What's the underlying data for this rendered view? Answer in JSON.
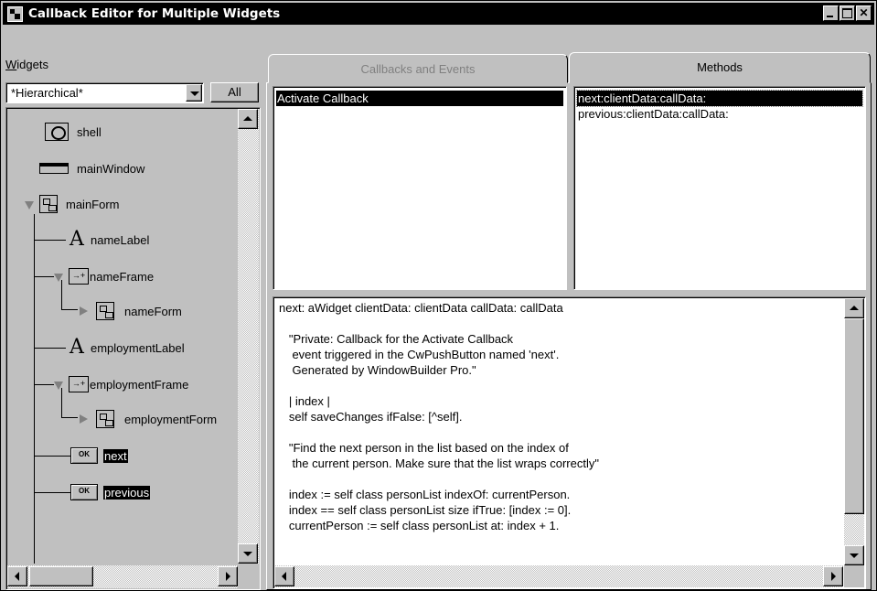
{
  "window": {
    "title": "Callback Editor for Multiple Widgets",
    "controls": [
      "minimize-icon",
      "maximize-icon",
      "close-icon"
    ]
  },
  "widgets_panel": {
    "label_underlined": "W",
    "label_rest": "idgets",
    "filter_value": "*Hierarchical*",
    "all_button": "All",
    "tree": [
      {
        "label": "shell",
        "icon": "shell-icon",
        "selected": false
      },
      {
        "label": "mainWindow",
        "icon": "main-window-icon",
        "selected": false
      },
      {
        "label": "mainForm",
        "icon": "form-icon",
        "expanded": true,
        "selected": false
      },
      {
        "label": "nameLabel",
        "icon": "label-icon",
        "selected": false
      },
      {
        "label": "nameFrame",
        "icon": "frame-icon",
        "expanded": true,
        "selected": false
      },
      {
        "label": "nameForm",
        "icon": "form-icon",
        "expanded": false,
        "selected": false
      },
      {
        "label": "employmentLabel",
        "icon": "label-icon",
        "selected": false
      },
      {
        "label": "employmentFrame",
        "icon": "frame-icon",
        "expanded": true,
        "selected": false
      },
      {
        "label": "employmentForm",
        "icon": "form-icon",
        "expanded": false,
        "selected": false
      },
      {
        "label": "next",
        "icon": "push-button-icon",
        "selected": true
      },
      {
        "label": "previous",
        "icon": "push-button-icon",
        "selected": true
      }
    ]
  },
  "tabs": [
    {
      "label": "Callbacks and Events",
      "active": false
    },
    {
      "label": "Methods",
      "active": true
    }
  ],
  "callbacks_list": [
    "Activate Callback"
  ],
  "methods_list": [
    "next:clientData:callData:",
    "previous:clientData:callData:"
  ],
  "code_lines": [
    "next: aWidget clientData: clientData callData: callData",
    "",
    "   \"Private: Callback for the Activate Callback",
    "    event triggered in the CwPushButton named 'next'.",
    "    Generated by WindowBuilder Pro.\"",
    "",
    "   | index |",
    "   self saveChanges ifFalse: [^self].",
    "",
    "   \"Find the next person in the list based on the index of",
    "    the current person. Make sure that the list wraps correctly\"",
    "",
    "   index := self class personList indexOf: currentPerson.",
    "   index == self class personList size ifTrue: [index := 0].",
    "   currentPerson := self class personList at: index + 1."
  ],
  "icons": {
    "ok_glyph": "OK",
    "frame_glyph": "→+",
    "label_glyph": "A"
  }
}
